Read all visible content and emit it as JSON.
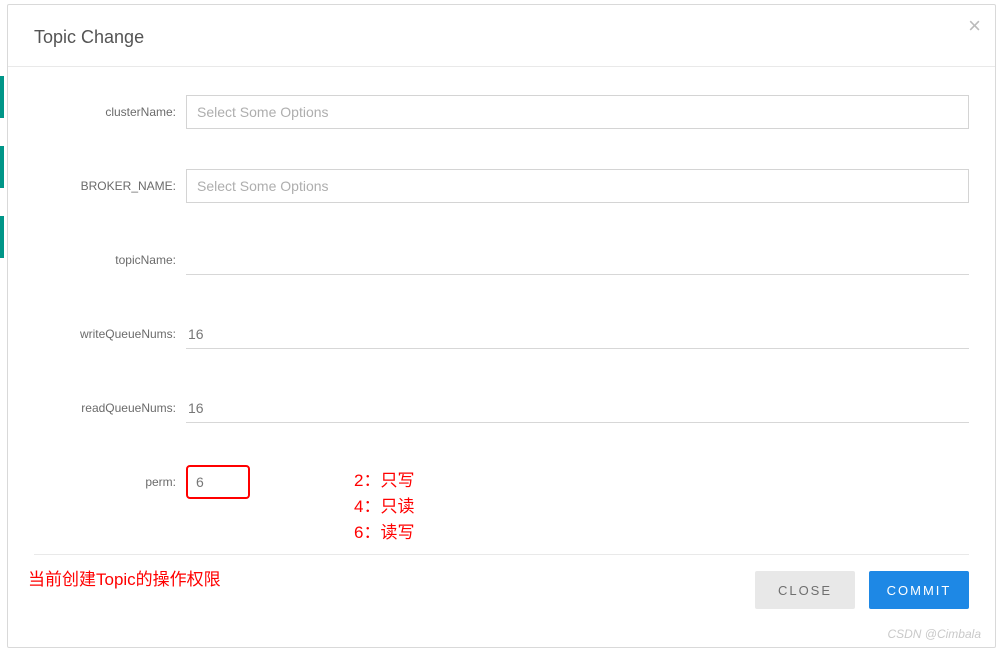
{
  "modal": {
    "title": "Topic Change",
    "close_icon": "×"
  },
  "fields": {
    "clusterName": {
      "label": "clusterName:",
      "placeholder": "Select Some Options"
    },
    "brokerName": {
      "label": "BROKER_NAME:",
      "placeholder": "Select Some Options"
    },
    "topicName": {
      "label": "topicName:",
      "value": ""
    },
    "writeQueueNums": {
      "label": "writeQueueNums:",
      "value": "16"
    },
    "readQueueNums": {
      "label": "readQueueNums:",
      "value": "16"
    },
    "perm": {
      "label": "perm:",
      "value": "6"
    }
  },
  "annotations": {
    "line1": "2：只写",
    "line2": "4：只读",
    "line3": "6：读写",
    "bottom": "当前创建Topic的操作权限"
  },
  "footer": {
    "close": "CLOSE",
    "commit": "COMMIT"
  },
  "watermark": "CSDN @Cimbala"
}
